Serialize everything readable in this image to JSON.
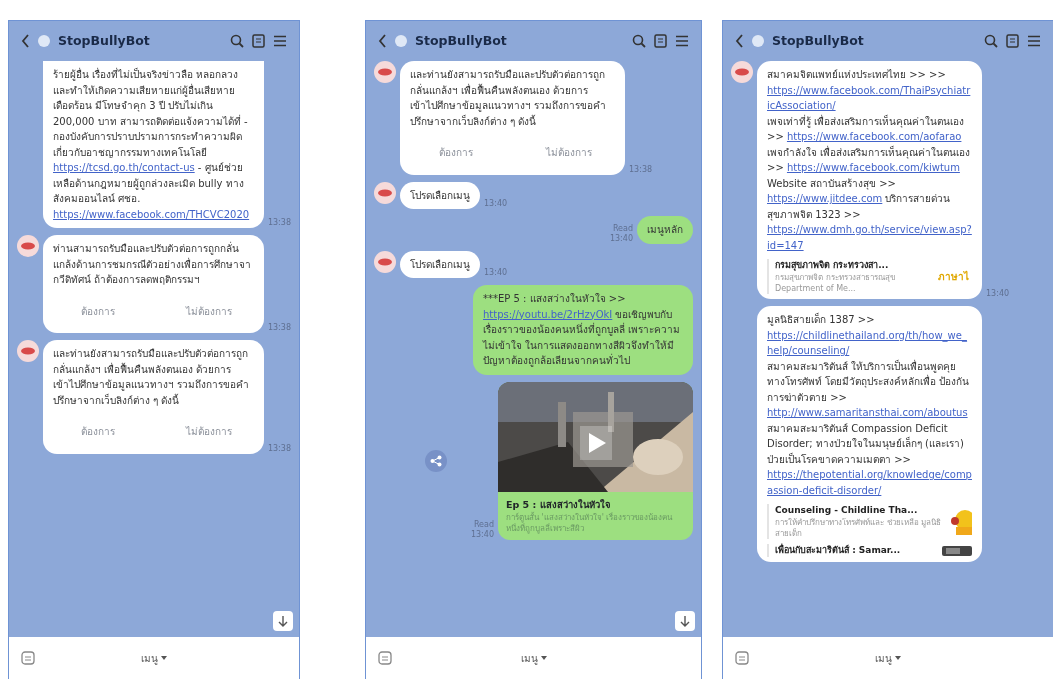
{
  "panels": [
    {
      "title": "StopBullyBot",
      "menu_label": "เมนู",
      "scroll_button": true,
      "messages": [
        {
          "kind": "bot",
          "avatar": false,
          "continued": true,
          "time": "13:38",
          "parts": [
            {
              "kind": "text",
              "text": "ร้ายผู้อื่น เรื่องที่ไม่เป็นจริงข่าวลือ หลอกลวง และทำให้เกิดความเสียหายแก่ผู้อื่นเสียหาย เดือดร้อน มีโทษจำคุก 3 ปี ปรับไม่เกิน 200,000 บาท สามารถติดต่อแจ้งความได้ที่ - กองบังคับการปราบปรามการกระทำความผิด เกี่ยวกับอาชญากรรมทางเทคโนโลยี "
            },
            {
              "kind": "link",
              "text": "https://tcsd.go.th/contact-us"
            },
            {
              "kind": "text",
              "text": " - ศูนย์ช่วยเหลือด้านกฎหมายผู้ถูกล่วงละเมิด bully ทางสังคมออนไลน์ ศชอ. "
            },
            {
              "kind": "link",
              "text": "https://www.facebook.com/THCVC2020"
            }
          ]
        },
        {
          "kind": "bot",
          "avatar": true,
          "time": "13:38",
          "parts": [
            {
              "kind": "text",
              "text": "ท่านสามารถรับมือและปรับตัวต่อการถูกกลั่นแกล้งด้านการชมกรณีตัวอย่างเพื่อการศึกษาจากวีดิทัศน์ ถ้าต้องการลดพฤติกรรมฯ"
            }
          ],
          "buttons": [
            "ต้องการ",
            "ไม่ต้องการ"
          ]
        },
        {
          "kind": "bot",
          "avatar": true,
          "time": "13:38",
          "parts": [
            {
              "kind": "text",
              "text": "และท่านยังสามารถรับมือและปรับตัวต่อการถูกกลั่นแกล้งฯ เพื่อฟื้นคืนพลังตนเอง ด้วยการเข้าไปศึกษาข้อมูลแนวทางฯ รวมถึงการขอคำปรึกษาจากเว็บลิงก์ต่าง ๆ ดังนี้"
            }
          ],
          "buttons": [
            "ต้องการ",
            "ไม่ต้องการ"
          ]
        }
      ]
    },
    {
      "title": "StopBullyBot",
      "menu_label": "เมนู",
      "scroll_button": true,
      "messages": [
        {
          "kind": "bot",
          "avatar": true,
          "time": "13:38",
          "parts": [
            {
              "kind": "text",
              "text": "และท่านยังสามารถรับมือและปรับตัวต่อการถูกกลั่นแกล้งฯ เพื่อฟื้นคืนพลังตนเอง ด้วยการเข้าไปศึกษาข้อมูลแนวทางฯ รวมถึงการขอคำปรึกษาจากเว็บลิงก์ต่าง ๆ ดังนี้"
            }
          ],
          "buttons": [
            "ต้องการ",
            "ไม่ต้องการ"
          ]
        },
        {
          "kind": "bot",
          "avatar": true,
          "time": "13:40",
          "parts": [
            {
              "kind": "text",
              "text": "โปรดเลือกเมนู"
            }
          ]
        },
        {
          "kind": "user",
          "read": "Read",
          "time": "13:40",
          "parts": [
            {
              "kind": "text",
              "text": "เมนูหลัก"
            }
          ]
        },
        {
          "kind": "bot",
          "avatar": true,
          "time": "13:40",
          "parts": [
            {
              "kind": "text",
              "text": "โปรดเลือกเมนู"
            }
          ]
        },
        {
          "kind": "user",
          "parts": [
            {
              "kind": "text",
              "text": "***EP 5 : แสงสว่างในหัวใจ >> "
            },
            {
              "kind": "link",
              "text": "https://youtu.be/2rHzyOkI"
            },
            {
              "kind": "text",
              "text": " ขอเชิญพบกับเรื่องราวของน้องคนหนึ่งที่ถูกบูลลี่ เพราะความไม่เข้าใจ ในการแสดงออกทางสีผิวจึงทำให้มีปัญหาต้องถูกล้อเลียนจากคนทั่วไป"
            }
          ]
        },
        {
          "kind": "user",
          "read": "Read",
          "time": "13:40",
          "share_button": true,
          "video": {
            "title": "Ep 5 : แสงสว่างในหัวใจ",
            "description": "การ์ตูนสั้น 'แสงสว่างในหัวใจ' เรื่องราวของน้องคนหนึ่งที่ถูกบูลลี่เพราะสีผิว"
          }
        }
      ]
    },
    {
      "title": "StopBullyBot",
      "menu_label": "เมนู",
      "scroll_button": false,
      "messages": [
        {
          "kind": "bot",
          "avatar": true,
          "time": "13:40",
          "parts": [
            {
              "kind": "text",
              "text": "สมาคมจิตแพทย์แห่งประเทศไทย >> >> "
            },
            {
              "kind": "link",
              "text": "https://www.facebook.com/ThaiPsychiatricAssociation/"
            },
            {
              "kind": "text",
              "text": " เพจเท่าที่รู้ เพื่อส่งเสริมการเห็นคุณค่าในตนเอง >> "
            },
            {
              "kind": "link",
              "text": "https://www.facebook.com/aofarao"
            },
            {
              "kind": "text",
              "text": " เพจกำลังใจ เพื่อส่งเสริมการเห็นคุณค่าในตนเอง >> "
            },
            {
              "kind": "link",
              "text": "https://www.facebook.com/kiwtum"
            },
            {
              "kind": "text",
              "text": " Website สถาบันสร้างสุข >> "
            },
            {
              "kind": "link",
              "text": "https://www.jitdee.com"
            },
            {
              "kind": "text",
              "text": " บริการสายด่วนสุขภาพจิต 1323 >> "
            },
            {
              "kind": "link",
              "text": "https://www.dmh.go.th/service/view.asp?id=147"
            }
          ],
          "previews": [
            {
              "title": "กรมสุขภาพจิต กระทรวงสา...",
              "description": "กรมสุขภาพจิต กระทรวงสาธารณสุข Department of Me...",
              "thumb_label": "ภาษาไ"
            }
          ]
        },
        {
          "kind": "bot",
          "avatar": false,
          "parts": [
            {
              "kind": "text",
              "text": "มูลนิธิสายเด็ก 1387 >> "
            },
            {
              "kind": "link",
              "text": "https://childlinethailand.org/th/how_we_help/counseling/"
            },
            {
              "kind": "text",
              "text": " สมาคมสะมาริตันส์ ให้บริการเป็นเพื่อนพูดคุยทางโทรศัพท์ โดยมีวัตถุประสงค์หลักเพื่อ ป้องกันการฆ่าตัวตาย >> "
            },
            {
              "kind": "link",
              "text": "http://www.samaritansthai.com/aboutus"
            },
            {
              "kind": "text",
              "text": " สมาคมสะมาริตันส์ Compassion Deficit Disorder; ทางป่วยใจในมนุษย์เล็กๆ (และเรา) ป่วยเป็นโรคขาดความเมตตา >> "
            },
            {
              "kind": "link",
              "text": "https://thepotential.org/knowledge/compassion-deficit-disorder/"
            }
          ],
          "previews": [
            {
              "title": "Counseling - Childline Tha...",
              "description": "การให้คำปรึกษาทางโทรศัพท์และ ช่วยเหลือ มูลนิธิสายเด็ก"
            },
            {
              "title": "เพื่อนกับสะมาริตันส์ : Samar..."
            }
          ]
        }
      ]
    }
  ]
}
